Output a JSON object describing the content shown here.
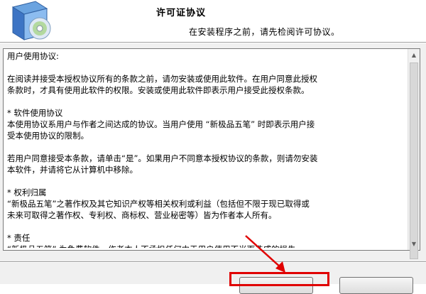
{
  "header": {
    "title": "许可证协议",
    "subtitle": "在安装程序之前，请先检阅许可协议。"
  },
  "license": {
    "text": "用户使用协议:\n\n在阅读并接受本授权协议所有的条款之前，请勿安装或使用此软件。在用户同意此授权\n条款时，才具有使用此软件的权限。安装或使用此软件即表示用户接受此授权条款。\n\n* 软件使用协议\n本使用协议系用户与作者之间达成的协议。当用户使用 “新极品五笔” 时即表示用户接\n受本使用协议的限制。\n\n若用户同意接受本条款，请单击“是”。如果用户不同意本授权协议的条款，则请勿安装\n本软件，并请将它从计算机中移除。\n\n* 权利归属\n“新极品五笔”之著作权及其它知识产权等相关权利或利益（包括但不限于现已取得或\n未来可取得之著作权、专利权、商标权、营业秘密等）皆为作者本人所有。\n\n* 责任\n“新极品五笔” 为免费软件，作者本人不承担任何由于用户使用不当而造成的损失。"
  },
  "icons": {
    "installer": "installer-cd-box-icon",
    "scroll_up": "scroll-up-arrow-icon",
    "scroll_down": "scroll-down-arrow-icon"
  },
  "colors": {
    "highlight": "#e00000",
    "arrow": "#e00000"
  }
}
